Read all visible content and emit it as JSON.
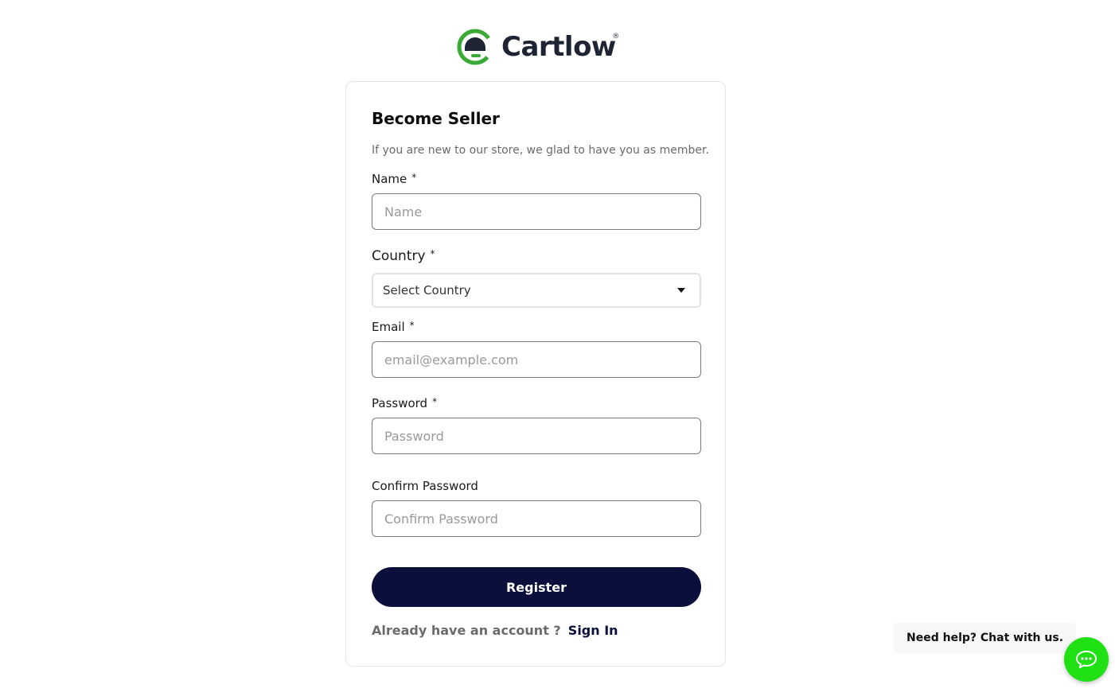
{
  "brand": {
    "name": "Cartlow",
    "registered_mark": "®",
    "colors": {
      "green": "#3aa935",
      "navy": "#1e2433"
    }
  },
  "form": {
    "title": "Become Seller",
    "subtitle": "If you are new to our store, we glad to have you as member.",
    "fields": {
      "name": {
        "label": "Name",
        "required_mark": "*",
        "placeholder": "Name",
        "value": ""
      },
      "country": {
        "label": "Country",
        "required_mark": "*",
        "selected": "Select Country"
      },
      "email": {
        "label": "Email",
        "required_mark": "*",
        "placeholder": "email@example.com",
        "value": ""
      },
      "password": {
        "label": "Password",
        "required_mark": "*",
        "placeholder": "Password",
        "value": ""
      },
      "confirm_password": {
        "label": "Confirm Password",
        "placeholder": "Confirm Password",
        "value": ""
      }
    },
    "register_label": "Register",
    "signin_prompt": "Already have an account ?",
    "signin_link": "Sign In"
  },
  "chat": {
    "bubble_text": "Need help? Chat with us.",
    "button_color": "#1ee012",
    "icon": "chat-icon"
  },
  "theme": {
    "button_bg": "#0a0f3c",
    "input_border": "#7a7a7a"
  }
}
